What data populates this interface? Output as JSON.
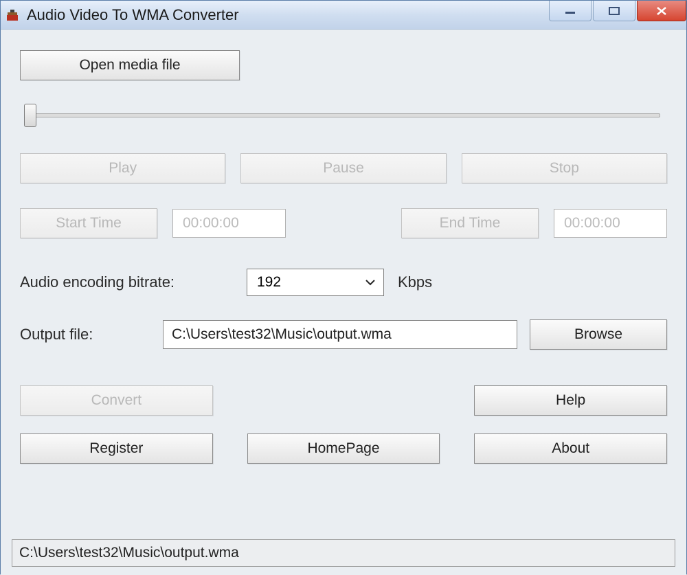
{
  "window": {
    "title": "Audio Video To WMA Converter"
  },
  "buttons": {
    "open_media": "Open media file",
    "play": "Play",
    "pause": "Pause",
    "stop": "Stop",
    "start_time": "Start Time",
    "end_time": "End Time",
    "browse": "Browse",
    "convert": "Convert",
    "help": "Help",
    "register": "Register",
    "homepage": "HomePage",
    "about": "About"
  },
  "fields": {
    "start_time_value": "00:00:00",
    "end_time_value": "00:00:00",
    "bitrate_label": "Audio encoding bitrate:",
    "bitrate_value": "192",
    "bitrate_unit": "Kbps",
    "output_label": "Output file:",
    "output_path": "C:\\Users\\test32\\Music\\output.wma"
  },
  "status": {
    "text": "C:\\Users\\test32\\Music\\output.wma"
  },
  "win_controls": {
    "min": "—",
    "max": "❐",
    "close": "✕"
  }
}
